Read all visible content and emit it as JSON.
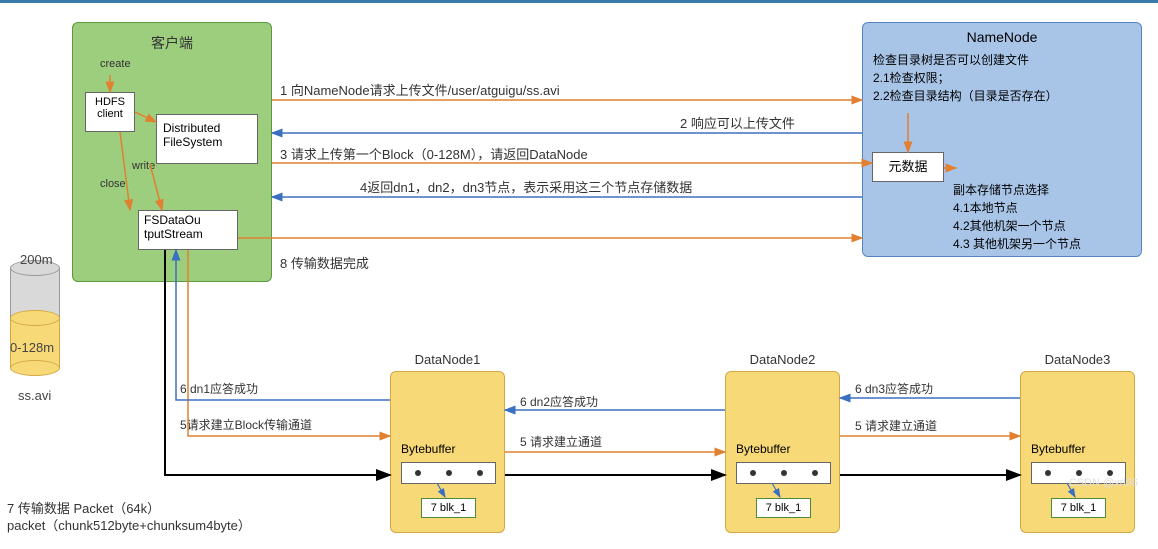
{
  "client": {
    "title": "客户端",
    "create": "create",
    "write": "write",
    "close": "close",
    "hdfs": "HDFS client",
    "dfs": "Distributed FileSystem",
    "fsdos": "FSDataOu tputStream"
  },
  "cylinder": {
    "m200": "200m",
    "m128": "0-128m",
    "file": "ss.avi"
  },
  "namenode": {
    "title": "NameNode",
    "check": "检查目录树是否可以创建文件\n2.1检查权限；\n2.2检查目录结构（目录是否存在）",
    "meta": "元数据",
    "replica": "副本存储节点选择\n4.1本地节点\n4.2其他机架一个节点\n4.3 其他机架另一个节点"
  },
  "datanode": {
    "dn1": "DataNode1",
    "dn2": "DataNode2",
    "dn3": "DataNode3",
    "bytebuffer": "Bytebuffer",
    "blk": "7 blk_1"
  },
  "arrows": {
    "l1": "1 向NameNode请求上传文件/user/atguigu/ss.avi",
    "l2": "2 响应可以上传文件",
    "l3": "3 请求上传第一个Block（0-128M），请返回DataNode",
    "l4": "4返回dn1，dn2，dn3节点，表示采用这三个节点存储数据",
    "l5": "5请求建立Block传输通道",
    "l5b": "5 请求建立通道",
    "l5c": "5 请求建立通道",
    "l6": "6 dn1应答成功",
    "l6b": "6 dn2应答成功",
    "l6c": "6 dn3应答成功",
    "l7": "7 传输数据 Packet（64k）\npacket（chunk512byte+chunksum4byte）",
    "l8": "8 传输数据完成"
  },
  "watermark": "CSDN @xrl66"
}
